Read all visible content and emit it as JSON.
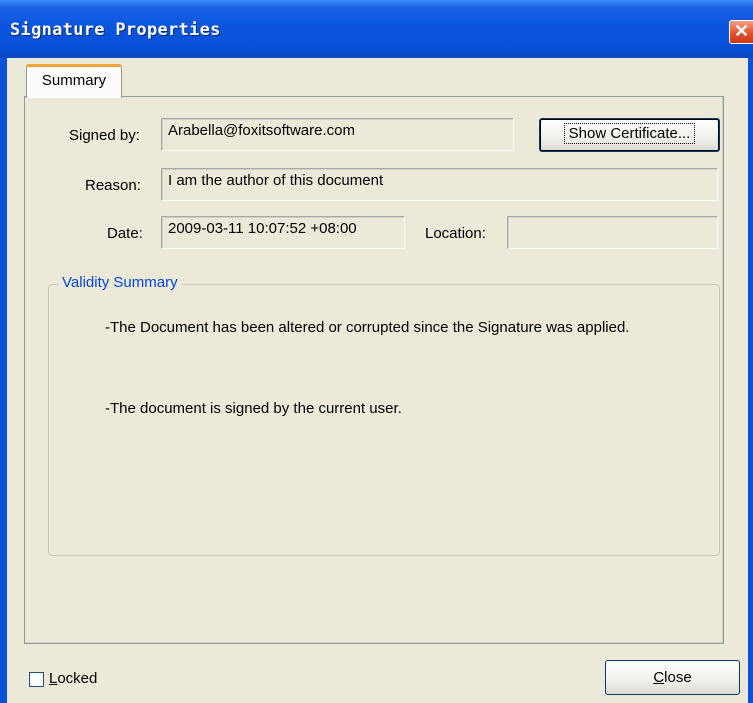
{
  "window": {
    "title": "Signature Properties",
    "close_glyph": "✕"
  },
  "tabs": [
    {
      "label": "Summary"
    }
  ],
  "summary": {
    "signed_by_label": "Signed by:",
    "signed_by_value": "Arabella@foxitsoftware.com",
    "show_certificate_label": "Show Certificate...",
    "reason_label": "Reason:",
    "reason_value": "I am the author of this document",
    "date_label": "Date:",
    "date_value": "2009-03-11 10:07:52 +08:00",
    "location_label": "Location:",
    "location_value": ""
  },
  "validity": {
    "legend": "Validity Summary",
    "messages": [
      "-The Document has been altered or corrupted since the Signature was applied.",
      "-The document is signed by the current user."
    ]
  },
  "footer": {
    "locked_label_first": "L",
    "locked_label_rest": "ocked",
    "locked_checked": false,
    "close_label_first": "C",
    "close_label_rest": "lose"
  },
  "colors": {
    "titlebar": "#0a55de",
    "dialog_bg": "#ece9d8",
    "legend_text": "#0046d5",
    "tab_highlight": "#f2a53a"
  }
}
